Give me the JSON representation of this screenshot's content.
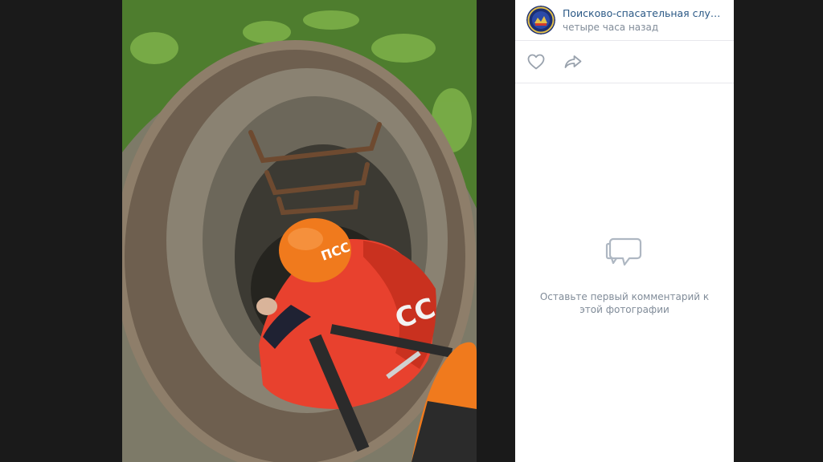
{
  "post": {
    "author": "Поисково-спасательная служба ...",
    "time": "четыре часа назад",
    "avatar_icon": "pss-emblem-icon"
  },
  "actions": {
    "like_icon": "heart-icon",
    "share_icon": "share-arrow-icon"
  },
  "comments": {
    "empty_icon": "comment-bubbles-icon",
    "empty_text": "Оставьте первый комментарий к этой фотографии"
  },
  "photo": {
    "helmet_text": "ПСС",
    "jacket_text": "СС"
  },
  "colors": {
    "link": "#2a5885",
    "secondary": "#818c99",
    "backdrop": "#1a1a1a",
    "helmet": "#f07a1d",
    "jacket": "#e8412e"
  }
}
